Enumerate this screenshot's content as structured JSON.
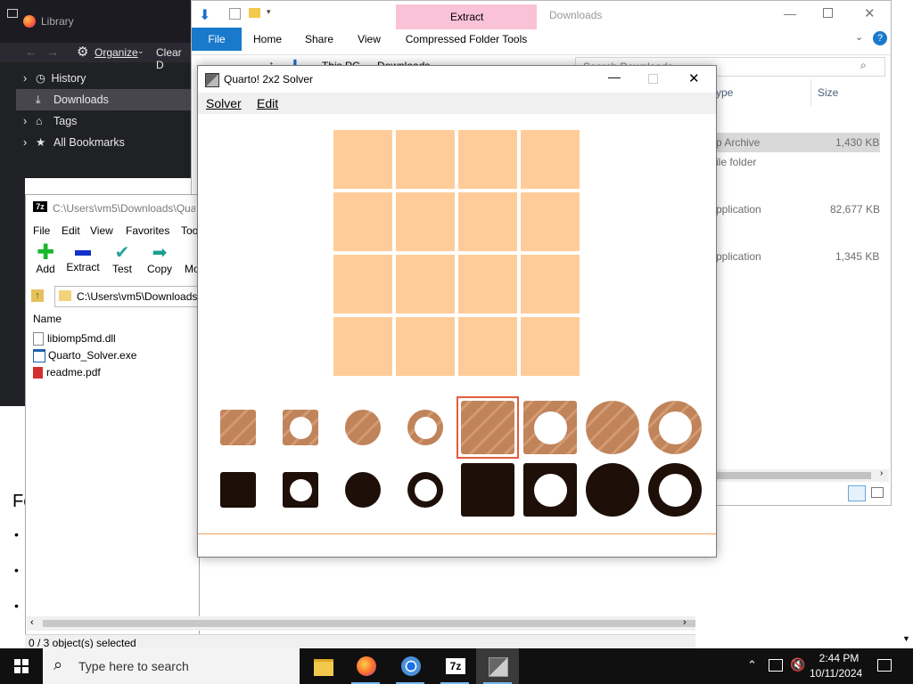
{
  "firefox_library": {
    "title": "Library",
    "organize_label": "Organize",
    "clear_label": "Clear D",
    "items": [
      {
        "label": "History",
        "selected": false
      },
      {
        "label": "Downloads",
        "selected": true
      },
      {
        "label": "Tags",
        "selected": false
      },
      {
        "label": "All Bookmarks",
        "selected": false
      }
    ]
  },
  "explorer": {
    "contextual_tab": "Extract",
    "title": "Downloads",
    "tabs": [
      "File",
      "Home",
      "Share",
      "View",
      "Compressed Folder Tools"
    ],
    "path": [
      "This PC",
      "Downloads"
    ],
    "search_placeholder": "Search Downloads",
    "columns": {
      "type": "ype",
      "size": "Size"
    },
    "rows": [
      {
        "type": "p Archive",
        "size": "1,430 KB"
      },
      {
        "type": "ile folder",
        "size": ""
      },
      {
        "type": "pplication",
        "size": "82,677 KB"
      },
      {
        "type": "pplication",
        "size": "1,345 KB"
      }
    ]
  },
  "sevenzip": {
    "title": "C:\\Users\\vm5\\Downloads\\Qua",
    "menu": [
      "File",
      "Edit",
      "View",
      "Favorites",
      "Too"
    ],
    "toolbar": [
      "Add",
      "Extract",
      "Test",
      "Copy",
      "Mo"
    ],
    "path": "C:\\Users\\vm5\\Downloads",
    "column_name": "Name",
    "files": [
      "libiomp5md.dll",
      "Quarto_Solver.exe",
      "readme.pdf"
    ],
    "status": "0 / 3 object(s) selected"
  },
  "quarto": {
    "title": "Quarto! 2x2 Solver",
    "menu": [
      "Solver",
      "Edit"
    ],
    "board": {
      "rows": 4,
      "cols": 4,
      "cell_color": "#ffcc99"
    },
    "light_color": "#c0835a",
    "dark_color": "#1e0f08",
    "selected_piece": 4
  },
  "background_page": {
    "heading": "Fe",
    "bullets": [
      "•",
      "•",
      "•"
    ]
  },
  "taskbar": {
    "search_placeholder": "Type here to search",
    "time": "2:44 PM",
    "date": "10/11/2024"
  }
}
